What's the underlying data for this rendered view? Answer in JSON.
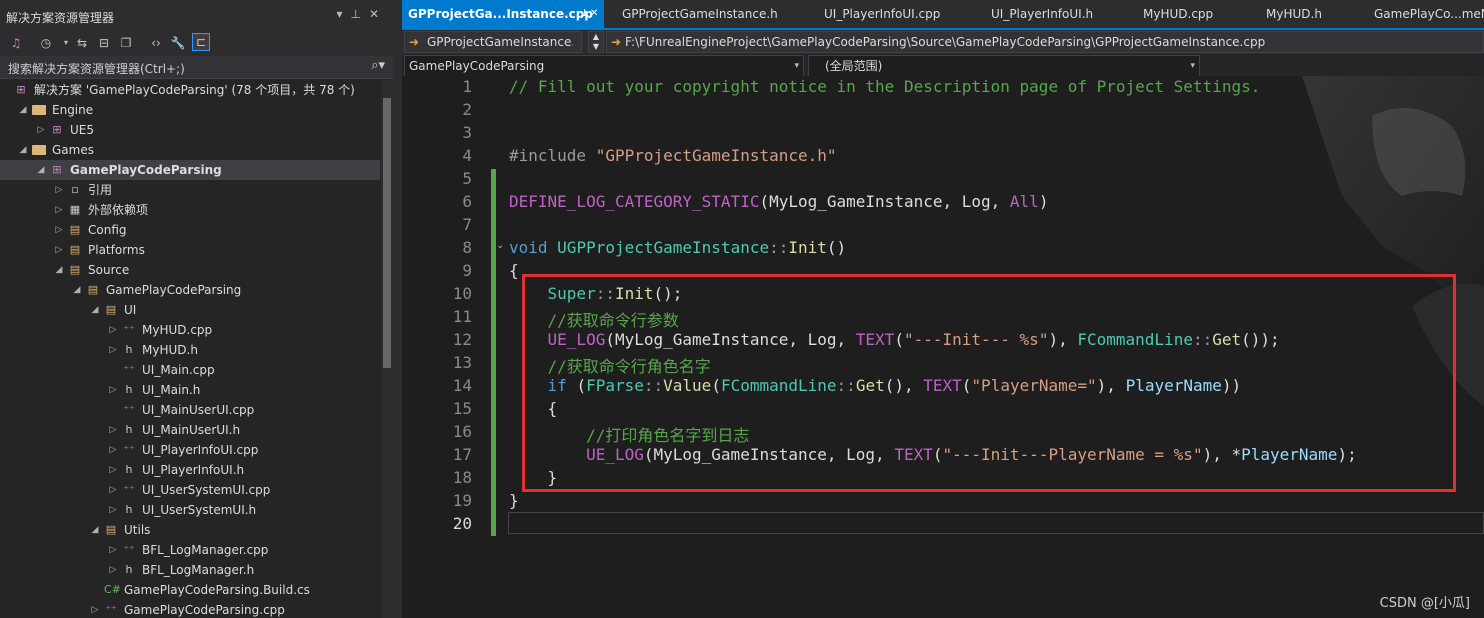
{
  "solution_explorer": {
    "title": "解决方案资源管理器",
    "search_placeholder": "搜索解决方案资源管理器(Ctrl+;)",
    "tree": [
      {
        "label": "解决方案 'GamePlayCodeParsing' (78 个项目，共 78 个)",
        "indent": 0,
        "icon": "solution-icon",
        "arrow": ""
      },
      {
        "label": "Engine",
        "indent": 1,
        "icon": "folder-icon",
        "arrow": "open"
      },
      {
        "label": "UE5",
        "indent": 2,
        "icon": "project-icon",
        "arrow": "closed"
      },
      {
        "label": "Games",
        "indent": 1,
        "icon": "folder-icon",
        "arrow": "open"
      },
      {
        "label": "GamePlayCodeParsing",
        "indent": 2,
        "icon": "project-icon",
        "arrow": "open",
        "selected": true,
        "bold": true
      },
      {
        "label": "引用",
        "indent": 3,
        "icon": "references-icon",
        "arrow": "closed"
      },
      {
        "label": "外部依赖项",
        "indent": 3,
        "icon": "external-deps-icon",
        "arrow": "closed"
      },
      {
        "label": "Config",
        "indent": 3,
        "icon": "filter-folder-icon",
        "arrow": "closed"
      },
      {
        "label": "Platforms",
        "indent": 3,
        "icon": "filter-folder-icon",
        "arrow": "closed"
      },
      {
        "label": "Source",
        "indent": 3,
        "icon": "filter-folder-icon",
        "arrow": "open"
      },
      {
        "label": "GamePlayCodeParsing",
        "indent": 4,
        "icon": "filter-folder-icon",
        "arrow": "open"
      },
      {
        "label": "UI",
        "indent": 5,
        "icon": "filter-folder-icon",
        "arrow": "open"
      },
      {
        "label": "MyHUD.cpp",
        "indent": 6,
        "icon": "cpp-file-icon",
        "arrow": "closed"
      },
      {
        "label": "MyHUD.h",
        "indent": 6,
        "icon": "header-file-icon",
        "arrow": "closed"
      },
      {
        "label": "UI_Main.cpp",
        "indent": 6,
        "icon": "cpp-file-icon",
        "arrow": ""
      },
      {
        "label": "UI_Main.h",
        "indent": 6,
        "icon": "header-file-icon",
        "arrow": "closed"
      },
      {
        "label": "UI_MainUserUI.cpp",
        "indent": 6,
        "icon": "cpp-file-icon",
        "arrow": ""
      },
      {
        "label": "UI_MainUserUI.h",
        "indent": 6,
        "icon": "header-file-icon",
        "arrow": "closed"
      },
      {
        "label": "UI_PlayerInfoUI.cpp",
        "indent": 6,
        "icon": "cpp-file-icon",
        "arrow": "closed"
      },
      {
        "label": "UI_PlayerInfoUI.h",
        "indent": 6,
        "icon": "header-file-icon",
        "arrow": "closed"
      },
      {
        "label": "UI_UserSystemUI.cpp",
        "indent": 6,
        "icon": "cpp-file-icon",
        "arrow": "closed"
      },
      {
        "label": "UI_UserSystemUI.h",
        "indent": 6,
        "icon": "header-file-icon",
        "arrow": "closed"
      },
      {
        "label": "Utils",
        "indent": 5,
        "icon": "filter-folder-icon",
        "arrow": "open"
      },
      {
        "label": "BFL_LogManager.cpp",
        "indent": 6,
        "icon": "cpp-file-icon",
        "arrow": "closed"
      },
      {
        "label": "BFL_LogManager.h",
        "indent": 6,
        "icon": "header-file-icon",
        "arrow": "closed"
      },
      {
        "label": "GamePlayCodeParsing.Build.cs",
        "indent": 5,
        "icon": "csharp-file-icon",
        "arrow": ""
      },
      {
        "label": "GamePlayCodeParsing.cpp",
        "indent": 5,
        "icon": "cpp-file-icon",
        "arrow": "closed"
      }
    ]
  },
  "tabs": [
    {
      "label": "GPProjectGa...Instance.cpp",
      "active": true
    },
    {
      "label": "GPProjectGameInstance.h"
    },
    {
      "label": "UI_PlayerInfoUI.cpp"
    },
    {
      "label": "UI_PlayerInfoUI.h"
    },
    {
      "label": "MyHUD.cpp"
    },
    {
      "label": "MyHUD.h"
    },
    {
      "label": "GamePlayCo...meMode.h"
    }
  ],
  "navbar": {
    "project_combo": "GPProjectGameInstance.",
    "file_path": "F:\\FUnrealEngineProject\\GamePlayCodeParsing\\Source\\GamePlayCodeParsing\\GPProjectGameInstance.cpp",
    "scope_left": "GamePlayCodeParsing",
    "scope_right": "(全局范围)"
  },
  "code_lines": [
    {
      "n": "1",
      "tokens": [
        [
          "cmt",
          "// Fill out your copyright notice in the Description page of Project Settings."
        ]
      ]
    },
    {
      "n": "2",
      "tokens": []
    },
    {
      "n": "3",
      "tokens": []
    },
    {
      "n": "4",
      "tokens": [
        [
          "ns",
          "#include "
        ],
        [
          "str",
          "\"GPProjectGameInstance.h\""
        ]
      ]
    },
    {
      "n": "5",
      "tokens": []
    },
    {
      "n": "6",
      "tokens": [
        [
          "mac",
          "DEFINE_LOG_CATEGORY_STATIC"
        ],
        [
          "",
          "(MyLog_GameInstance, Log, "
        ],
        [
          "mac",
          "All"
        ],
        [
          "",
          ")"
        ]
      ]
    },
    {
      "n": "7",
      "tokens": []
    },
    {
      "n": "8",
      "tokens": [
        [
          "kw",
          "void "
        ],
        [
          "typ",
          "UGPProjectGameInstance"
        ],
        [
          "ns",
          "::"
        ],
        [
          "fn",
          "Init"
        ],
        [
          "",
          "()"
        ]
      ]
    },
    {
      "n": "9",
      "tokens": [
        [
          "",
          "{"
        ]
      ]
    },
    {
      "n": "10",
      "tokens": [
        [
          "",
          "    "
        ],
        [
          "typ",
          "Super"
        ],
        [
          "ns",
          "::"
        ],
        [
          "fn",
          "Init"
        ],
        [
          "",
          "();"
        ]
      ]
    },
    {
      "n": "11",
      "tokens": [
        [
          "",
          "    "
        ],
        [
          "cmt",
          "//获取命令行参数"
        ]
      ]
    },
    {
      "n": "12",
      "tokens": [
        [
          "",
          "    "
        ],
        [
          "mac",
          "UE_LOG"
        ],
        [
          "",
          "(MyLog_GameInstance, Log, "
        ],
        [
          "mac",
          "TEXT"
        ],
        [
          "",
          "("
        ],
        [
          "str",
          "\"---Init--- %s\""
        ],
        [
          "",
          "), "
        ],
        [
          "typ",
          "FCommandLine"
        ],
        [
          "ns",
          "::"
        ],
        [
          "fn",
          "Get"
        ],
        [
          "",
          "());"
        ]
      ]
    },
    {
      "n": "13",
      "tokens": [
        [
          "",
          "    "
        ],
        [
          "cmt",
          "//获取命令行角色名字"
        ]
      ]
    },
    {
      "n": "14",
      "tokens": [
        [
          "",
          "    "
        ],
        [
          "kw",
          "if "
        ],
        [
          "",
          "("
        ],
        [
          "typ",
          "FParse"
        ],
        [
          "ns",
          "::"
        ],
        [
          "fn",
          "Value"
        ],
        [
          "",
          "("
        ],
        [
          "typ",
          "FCommandLine"
        ],
        [
          "ns",
          "::"
        ],
        [
          "fn",
          "Get"
        ],
        [
          "",
          "(), "
        ],
        [
          "mac",
          "TEXT"
        ],
        [
          "",
          "("
        ],
        [
          "str",
          "\"PlayerName=\""
        ],
        [
          "",
          "), "
        ],
        [
          "par",
          "PlayerName"
        ],
        [
          "",
          "))"
        ]
      ]
    },
    {
      "n": "15",
      "tokens": [
        [
          "",
          "    {"
        ]
      ]
    },
    {
      "n": "16",
      "tokens": [
        [
          "",
          "        "
        ],
        [
          "cmt",
          "//打印角色名字到日志"
        ]
      ]
    },
    {
      "n": "17",
      "tokens": [
        [
          "",
          "        "
        ],
        [
          "mac",
          "UE_LOG"
        ],
        [
          "",
          "(MyLog_GameInstance, Log, "
        ],
        [
          "mac",
          "TEXT"
        ],
        [
          "",
          "("
        ],
        [
          "str",
          "\"---Init---PlayerName = %s\""
        ],
        [
          "",
          "), *"
        ],
        [
          "par",
          "PlayerName"
        ],
        [
          "",
          ");"
        ]
      ]
    },
    {
      "n": "18",
      "tokens": [
        [
          "",
          "    }"
        ]
      ]
    },
    {
      "n": "19",
      "tokens": [
        [
          "",
          "}"
        ]
      ]
    },
    {
      "n": "20",
      "tokens": []
    }
  ],
  "watermark": "CSDN @[小瓜]"
}
